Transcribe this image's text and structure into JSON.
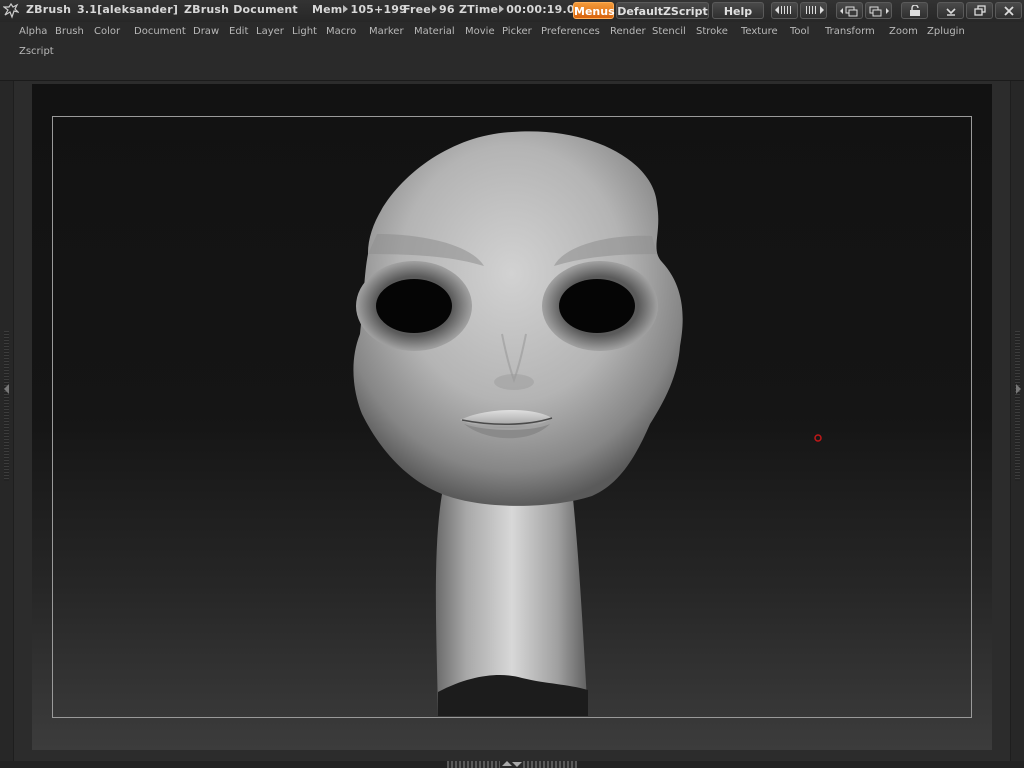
{
  "titlebar": {
    "app_name": "ZBrush",
    "version_user": "3.1[aleksander]",
    "document_title": "ZBrush  Document",
    "mem_label": "Mem",
    "mem_value": "105+199",
    "free_label": "Free",
    "free_value": "96",
    "ztime_label": "ZTime",
    "ztime_value": "00:00:19.00",
    "menus_button": "Menus",
    "zscript_button": "DefaultZScript",
    "help_button": "Help"
  },
  "menu": {
    "items": [
      "Alpha",
      "Brush",
      "Color",
      "Document",
      "Draw",
      "Edit",
      "Layer",
      "Light",
      "Macro",
      "Marker",
      "Material",
      "Movie",
      "Picker",
      "Preferences",
      "Render",
      "Stencil",
      "Stroke",
      "Texture",
      "Tool",
      "Transform",
      "Zoom",
      "Zplugin",
      "Zscript"
    ]
  },
  "colors": {
    "accent": "#e8781a",
    "cursor_marker": "#c01818"
  }
}
